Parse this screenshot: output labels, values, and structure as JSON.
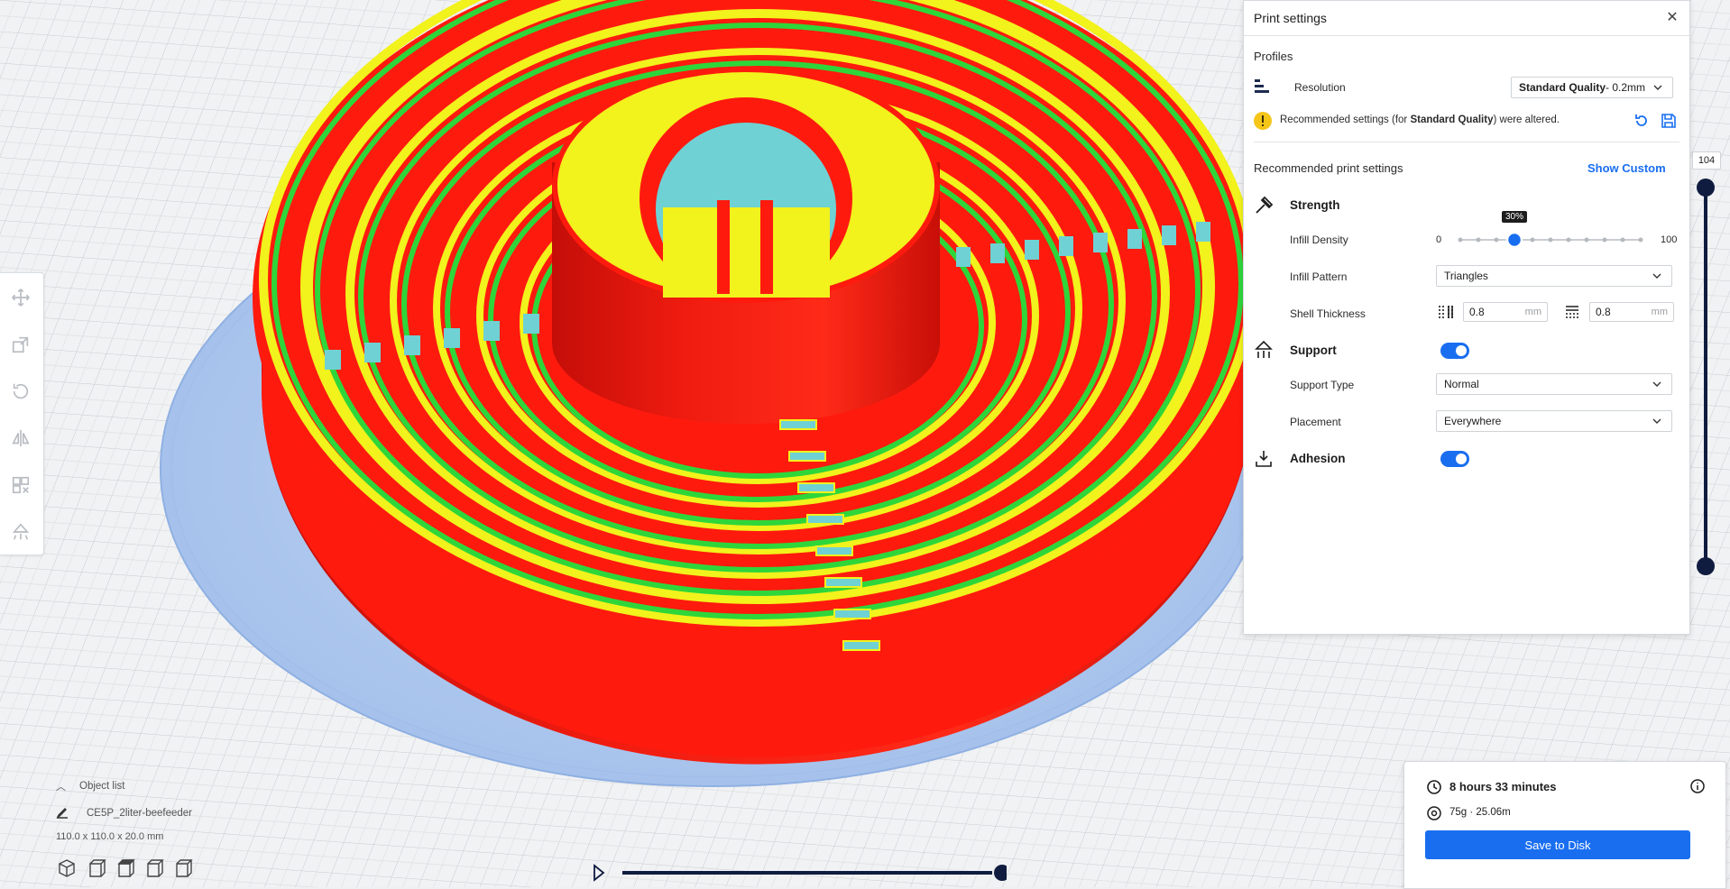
{
  "panel": {
    "title": "Print settings",
    "profiles_label": "Profiles",
    "resolution_label": "Resolution",
    "resolution_value_bold": "Standard Quality",
    "resolution_value_rest": " - 0.2mm",
    "alert_pre": "Recommended settings (for ",
    "alert_bold": "Standard Quality",
    "alert_post": ") were altered.",
    "recommended_title": "Recommended print settings",
    "show_custom": "Show Custom",
    "strength_title": "Strength",
    "infill_density_label": "Infill Density",
    "infill_min": "0",
    "infill_max": "100",
    "infill_value": "30%",
    "infill_fraction": 0.3,
    "infill_pattern_label": "Infill Pattern",
    "infill_pattern_value": "Triangles",
    "shell_thickness_label": "Shell Thickness",
    "wall_thickness": "0.8",
    "top_bottom_thickness": "0.8",
    "unit_mm": "mm",
    "support_title": "Support",
    "support_enabled": true,
    "support_type_label": "Support Type",
    "support_type_value": "Normal",
    "placement_label": "Placement",
    "placement_value": "Everywhere",
    "adhesion_title": "Adhesion",
    "adhesion_enabled": true
  },
  "layer_slider": {
    "value": "104"
  },
  "object_list": {
    "label": "Object list",
    "object_name": "CE5P_2liter-beefeeder",
    "dimensions": "110.0 x 110.0 x 20.0 mm"
  },
  "summary": {
    "time": "8 hours 33 minutes",
    "material": "75g · 25.06m",
    "save_label": "Save to Disk"
  },
  "colors": {
    "accent": "#196ef0",
    "wall_red": "#ff1a0e",
    "infill_yellow": "#f2f21c",
    "inner_wall_green": "#2ed63a",
    "support_cyan": "#6fd1d3",
    "build_plate_blue": "#a9c6ef",
    "slider_navy": "#0f1c3f"
  }
}
